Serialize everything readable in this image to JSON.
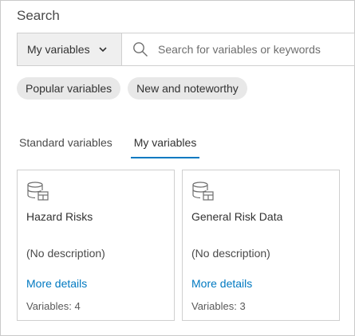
{
  "panel": {
    "title": "Search"
  },
  "search": {
    "scope_label": "My variables",
    "placeholder": "Search for variables or keywords",
    "value": ""
  },
  "chips": [
    {
      "label": "Popular variables"
    },
    {
      "label": "New and noteworthy"
    }
  ],
  "tabs": [
    {
      "label": "Standard variables",
      "active": false
    },
    {
      "label": "My variables",
      "active": true
    }
  ],
  "cards": [
    {
      "icon": "database-icon",
      "title": "Hazard Risks",
      "description": "(No description)",
      "link": "More details",
      "count": "Variables: 4"
    },
    {
      "icon": "database-icon",
      "title": "General Risk Data",
      "description": "(No description)",
      "link": "More details",
      "count": "Variables: 3"
    }
  ],
  "colors": {
    "accent": "#0079c1",
    "chip_bg": "#e8e8e8",
    "select_bg": "#efefef"
  }
}
